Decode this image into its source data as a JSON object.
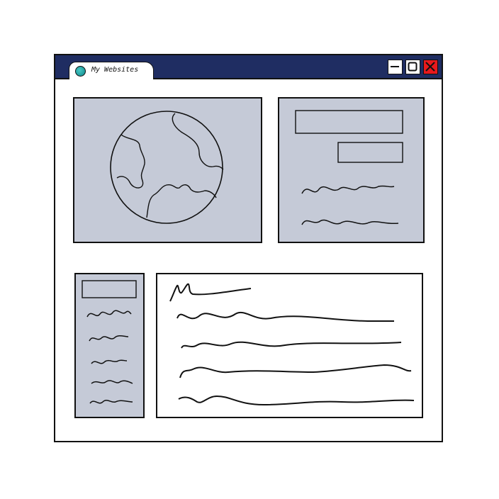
{
  "window": {
    "tab_title": "My Websites",
    "tab_icon": "globe-icon",
    "controls": {
      "minimize_icon": "minimize-icon",
      "maximize_icon": "maximize-icon",
      "close_icon": "close-icon"
    }
  },
  "content": {
    "hero_image": "globe-icon",
    "colors": {
      "titlebar": "#1f2d62",
      "panel_fill": "#c5cad7",
      "close_button": "#e8191d",
      "tab_icon": "#2aa9ab"
    }
  }
}
